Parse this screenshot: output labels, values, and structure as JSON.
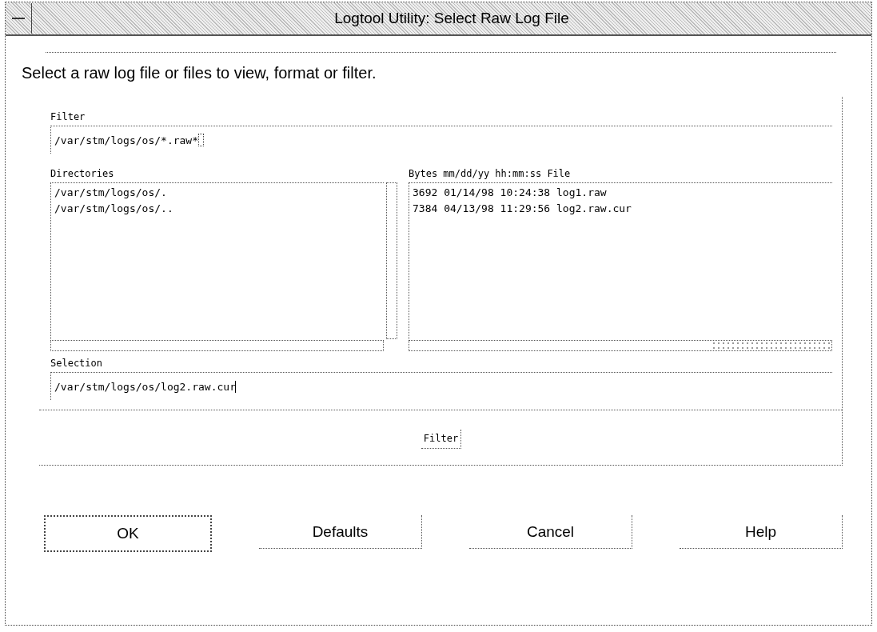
{
  "window": {
    "title": "Logtool Utility:  Select Raw Log File"
  },
  "instruction": "Select a raw log file or files to view, format or filter.",
  "filter": {
    "label": "Filter",
    "value": "/var/stm/logs/os/*.raw*"
  },
  "directories": {
    "label": "Directories",
    "items": [
      {
        "text": "/var/stm/logs/os/.",
        "selected": false
      },
      {
        "text": "/var/stm/logs/os/..",
        "selected": false
      }
    ]
  },
  "files": {
    "label": "Bytes mm/dd/yy hh:mm:ss File",
    "items": [
      {
        "text": "3692 01/14/98 10:24:38 log1.raw",
        "selected": false
      },
      {
        "text": "7384 04/13/98 11:29:56 log2.raw.cur",
        "selected": false
      }
    ]
  },
  "selection": {
    "label": "Selection",
    "value": "/var/stm/logs/os/log2.raw.cur"
  },
  "filter_button": "Filter",
  "buttons": [
    {
      "label": "OK",
      "default": true
    },
    {
      "label": "Defaults",
      "default": false
    },
    {
      "label": "Cancel",
      "default": false
    },
    {
      "label": "Help",
      "default": false
    }
  ]
}
